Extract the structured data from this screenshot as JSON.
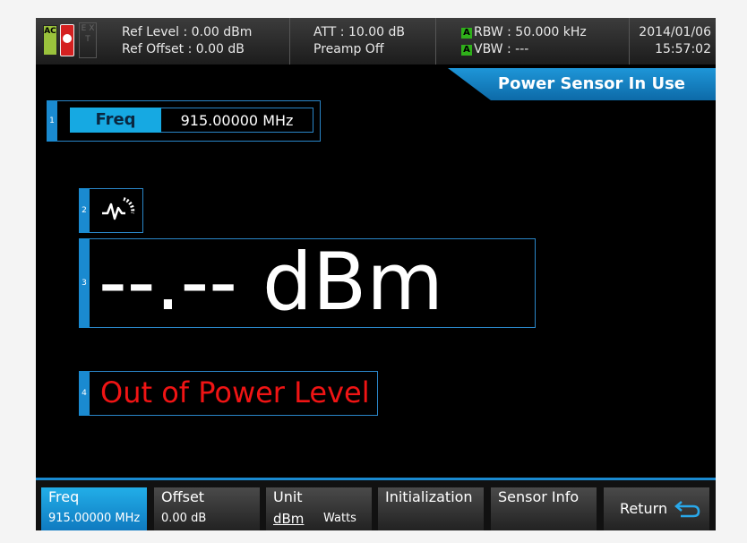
{
  "status_icons": {
    "ac": "AC",
    "ext": "E X T",
    "ac_icon": "ac-power-icon",
    "battery_icon": "battery-alert-icon",
    "ext_icon": "ext-ref-icon"
  },
  "header": {
    "ref_level": "Ref Level : 0.00 dBm",
    "ref_offset": "Ref Offset : 0.00 dB",
    "att": "ATT : 10.00 dB",
    "preamp": "Preamp Off",
    "rbw_badge": "A",
    "rbw": "RBW : 50.000 kHz",
    "vbw_badge": "A",
    "vbw": "VBW : ---",
    "date": "2014/01/06",
    "time": "15:57:02"
  },
  "banner": "Power Sensor In Use",
  "freq": {
    "marker": "1",
    "label": "Freq",
    "value": "915.00000 MHz"
  },
  "sensor": {
    "marker": "2",
    "icon": "power-sensor-icon"
  },
  "reading": {
    "marker": "3",
    "value": "--.-- dBm"
  },
  "status": {
    "marker": "4",
    "text": "Out of Power Level"
  },
  "softkeys": [
    {
      "title": "Freq",
      "value": "915.00000 MHz"
    },
    {
      "title": "Offset",
      "value": "0.00 dB"
    },
    {
      "title": "Unit",
      "option_selected": "dBm",
      "option_other": "Watts"
    },
    {
      "title": "Initialization"
    },
    {
      "title": "Sensor Info"
    },
    {
      "title": "Return",
      "icon": "return-arrow-icon"
    }
  ],
  "colors": {
    "accent": "#1a8ad0",
    "active_key": "#16a9e2",
    "alert": "#f01414",
    "rbw_badge": "#2fb01a"
  }
}
